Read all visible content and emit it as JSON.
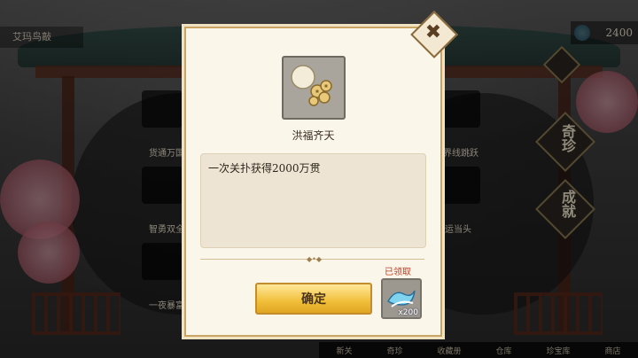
{
  "header": {
    "location": "艾玛鸟敲",
    "currency_value": "2400"
  },
  "side_menu_left": {
    "items": [
      {
        "label": "货通万国",
        "icon": "ship-icon"
      },
      {
        "label": "智勇双全",
        "icon": "cards-icon"
      },
      {
        "label": "一夜暴富",
        "icon": "coins-icon"
      }
    ]
  },
  "side_menu_right": {
    "items": [
      {
        "label": "界线跳跃",
        "icon": "lines-icon"
      },
      {
        "label": "鸿运当头",
        "icon": "coins-icon"
      }
    ]
  },
  "right_tabs": {
    "treasure": "奇珍",
    "achievement": "成就"
  },
  "bottom_nav": [
    "新关",
    "奇珍",
    "收藏册",
    "仓库",
    "珍宝库",
    "商店"
  ],
  "dialog": {
    "item_title": "洪福齐天",
    "description": "一次关扑获得2000万贯",
    "confirm_label": "确定",
    "reward_count": "x200",
    "claimed_label": "已领取",
    "close_symbol": "✖"
  },
  "colors": {
    "button_gold": "#f1bf3a",
    "claimed_red": "#c23a22",
    "dialog_bg": "#fbf6ea"
  }
}
